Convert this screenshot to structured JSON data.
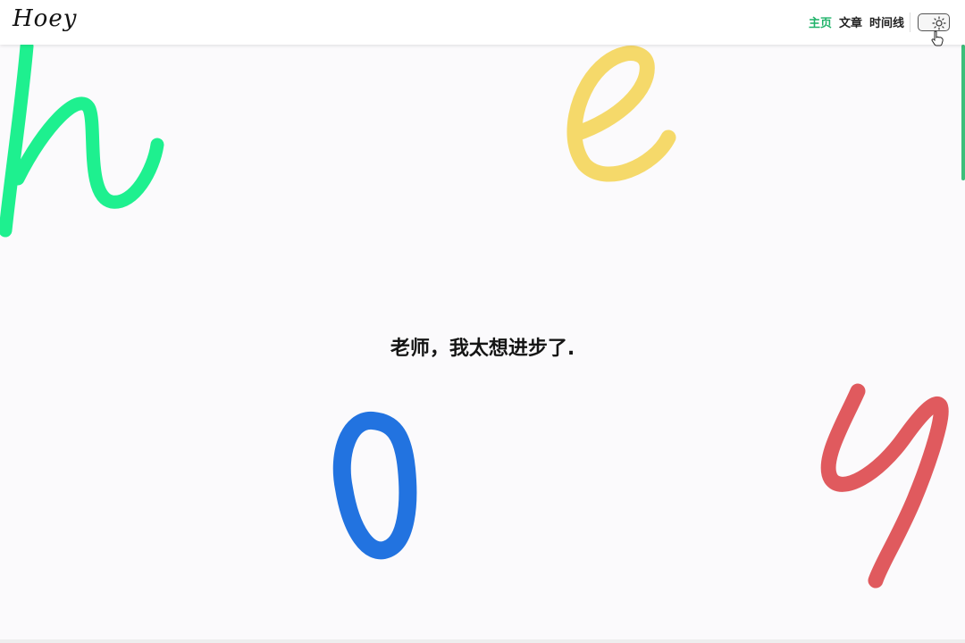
{
  "header": {
    "logo": "Hoey",
    "nav": [
      {
        "label": "主页",
        "active": true
      },
      {
        "label": "文章",
        "active": false
      },
      {
        "label": "时间线",
        "active": false
      }
    ],
    "theme_toggle_icon": "sun-icon"
  },
  "hero": {
    "tagline": "老师，我太想进步了.",
    "letters": [
      {
        "char": "h",
        "color": "#1ef08f"
      },
      {
        "char": "e",
        "color": "#f5d96a"
      },
      {
        "char": "o",
        "color": "#2273e0"
      },
      {
        "char": "y",
        "color": "#e05a5e"
      }
    ]
  },
  "colors": {
    "accent": "#20b36a",
    "scrollbar": "#3dbf7a",
    "background": "#fbfafc"
  }
}
